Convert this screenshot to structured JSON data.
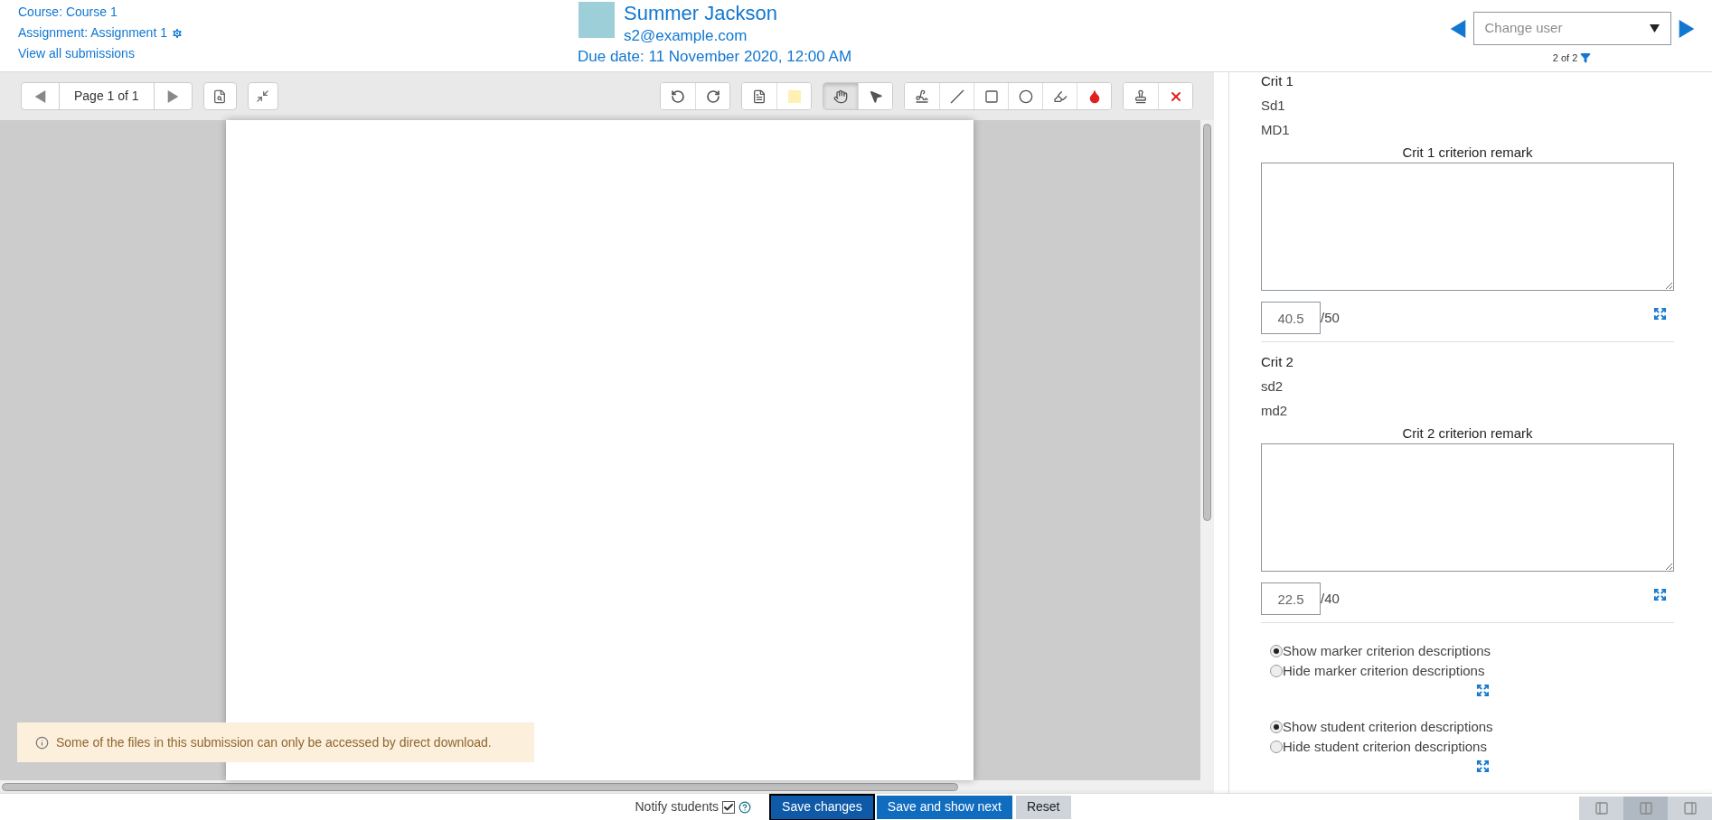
{
  "header": {
    "course_link": "Course: Course 1",
    "assignment_link": "Assignment: Assignment 1",
    "view_all_link": "View all submissions",
    "user_name": "Summer Jackson",
    "user_email": "s2@example.com",
    "due_date": "Due date: 11 November 2020, 12:00 AM",
    "change_user": {
      "placeholder": "Change user"
    },
    "count": "2 of 2"
  },
  "toolbar": {
    "page_label": "Page 1 of 1",
    "tool_groups": [
      [
        {
          "kind": "rotate-left",
          "selected": false
        },
        {
          "kind": "rotate-right",
          "selected": false
        }
      ],
      [
        {
          "kind": "comment",
          "selected": false
        },
        {
          "kind": "swatch",
          "selected": false,
          "color": "#fff0b3"
        }
      ],
      [
        {
          "kind": "hand",
          "selected": true
        },
        {
          "kind": "pointer",
          "selected": false
        }
      ],
      [
        {
          "kind": "pen",
          "selected": false
        },
        {
          "kind": "line",
          "selected": false
        },
        {
          "kind": "rectangle",
          "selected": false
        },
        {
          "kind": "oval",
          "selected": false
        },
        {
          "kind": "highlight",
          "selected": false
        },
        {
          "kind": "droplet",
          "selected": false
        }
      ],
      [
        {
          "kind": "stamp",
          "selected": false
        },
        {
          "kind": "delete",
          "selected": false
        }
      ]
    ]
  },
  "notice": "Some of the files in this submission can only be accessed by direct download.",
  "criteria": [
    {
      "name": "Crit 1",
      "student_description": "Sd1",
      "marker_description": "MD1",
      "remark_label": "Crit 1 criterion remark",
      "score": "40.5",
      "max": "/50"
    },
    {
      "name": "Crit 2",
      "student_description": "sd2",
      "marker_description": "md2",
      "remark_label": "Crit 2 criterion remark",
      "score": "22.5",
      "max": "/40"
    }
  ],
  "option_groups": [
    [
      {
        "label": "Show marker criterion descriptions",
        "selected": true
      },
      {
        "label": "Hide marker criterion descriptions",
        "selected": false
      }
    ],
    [
      {
        "label": "Show student criterion descriptions",
        "selected": true
      },
      {
        "label": "Hide student criterion descriptions",
        "selected": false
      }
    ]
  ],
  "footer": {
    "notify_label": "Notify students",
    "notify_checked": true,
    "buttons": [
      {
        "label": "Save changes",
        "kind": "primary-focused"
      },
      {
        "label": "Save and show next",
        "kind": "primary"
      },
      {
        "label": "Reset",
        "kind": "secondary"
      }
    ],
    "layouts": [
      {
        "kind": "left",
        "selected": false
      },
      {
        "kind": "both",
        "selected": true
      },
      {
        "kind": "right",
        "selected": false
      }
    ]
  }
}
